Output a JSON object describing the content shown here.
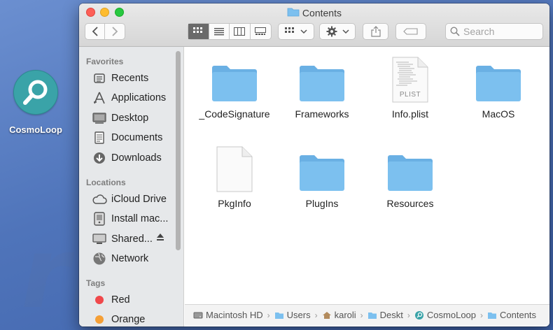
{
  "desktop": {
    "app_icon_label": "CosmoLoop"
  },
  "window": {
    "title": "Contents",
    "search_placeholder": "Search"
  },
  "sidebar": {
    "favorites_header": "Favorites",
    "favorites": [
      {
        "label": "Recents",
        "icon": "clock-icon"
      },
      {
        "label": "Applications",
        "icon": "applications-icon"
      },
      {
        "label": "Desktop",
        "icon": "desktop-icon"
      },
      {
        "label": "Documents",
        "icon": "document-icon"
      },
      {
        "label": "Downloads",
        "icon": "download-icon"
      }
    ],
    "locations_header": "Locations",
    "locations": [
      {
        "label": "iCloud Drive",
        "icon": "cloud-icon"
      },
      {
        "label": "Install mac...",
        "icon": "disk-icon"
      },
      {
        "label": "Shared...",
        "icon": "display-icon"
      },
      {
        "label": "Network",
        "icon": "globe-icon"
      }
    ],
    "tags_header": "Tags",
    "tags": [
      {
        "label": "Red",
        "color": "#f0484b"
      },
      {
        "label": "Orange",
        "color": "#f59f36"
      }
    ]
  },
  "files": [
    {
      "name": "_CodeSignature",
      "kind": "folder"
    },
    {
      "name": "Frameworks",
      "kind": "folder"
    },
    {
      "name": "Info.plist",
      "kind": "plist",
      "badge": "PLIST"
    },
    {
      "name": "MacOS",
      "kind": "folder"
    },
    {
      "name": "PkgInfo",
      "kind": "file"
    },
    {
      "name": "PlugIns",
      "kind": "folder"
    },
    {
      "name": "Resources",
      "kind": "folder"
    }
  ],
  "pathbar": [
    {
      "label": "Macintosh HD",
      "icon": "hard-drive-icon"
    },
    {
      "label": "Users",
      "icon": "folder-icon"
    },
    {
      "label": "karoli",
      "icon": "home-icon"
    },
    {
      "label": "Deskt",
      "icon": "folder-icon"
    },
    {
      "label": "CosmoLoop",
      "icon": "app-search-icon"
    },
    {
      "label": "Contents",
      "icon": "folder-icon"
    }
  ],
  "watermark": {
    "line1": "PC",
    "line2": "risk.com"
  },
  "colors": {
    "folder": "#7cc0ef",
    "folder_tab": "#6ab0e4",
    "accent": "#3aa3a8"
  }
}
